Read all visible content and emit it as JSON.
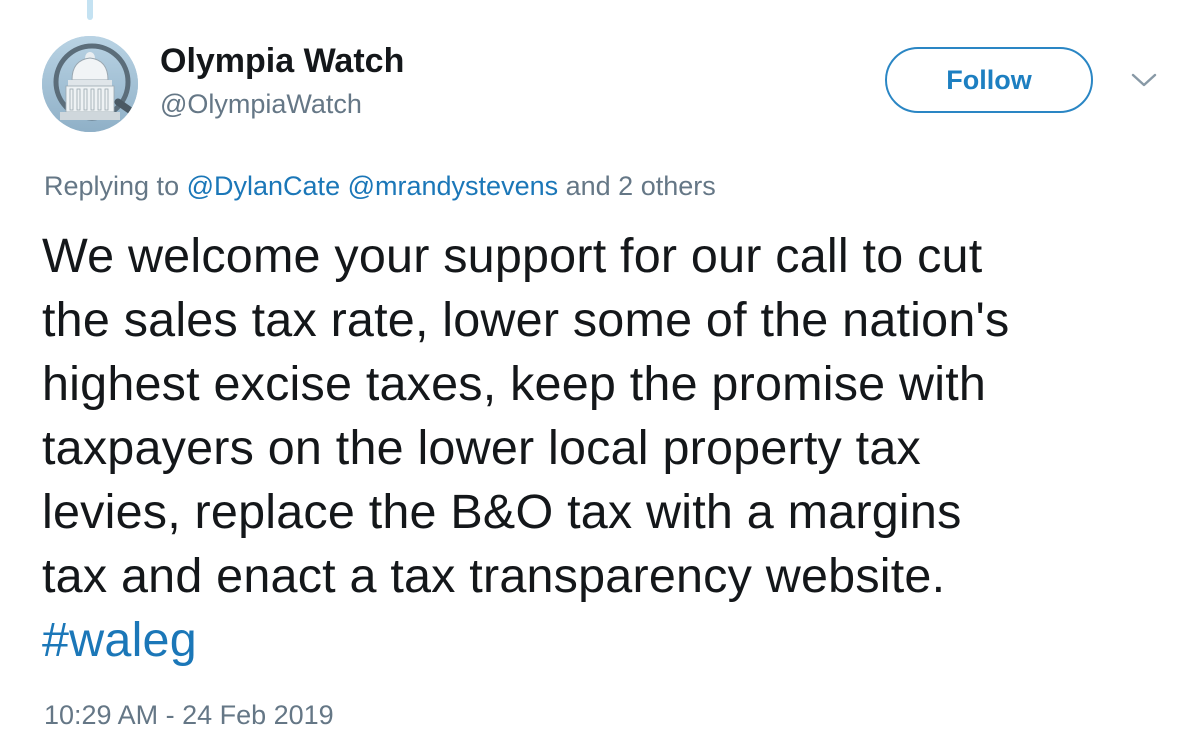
{
  "author": {
    "display_name": "Olympia Watch",
    "handle": "@OlympiaWatch",
    "avatar_icon": "capitol-dome-avatar"
  },
  "follow_button": {
    "label": "Follow"
  },
  "menu": {
    "icon": "chevron-down-icon"
  },
  "reply_context": {
    "prefix": "Replying to",
    "mentions": [
      "@DylanCate",
      "@mrandystevens"
    ],
    "suffix": "and 2 others"
  },
  "tweet": {
    "lines": [
      "We welcome your support for our call to cut",
      "the sales tax rate, lower some of the nation's",
      "highest excise taxes, keep the promise with",
      "taxpayers on the lower local property tax",
      "levies, replace the B&O tax with a margins",
      "tax and enact a tax transparency website."
    ],
    "hashtag": "#waleg"
  },
  "timestamp": "10:29 AM - 24 Feb 2019",
  "colors": {
    "link": "#1b77b8",
    "secondary_text": "#657786",
    "primary_text": "#14171a",
    "thread_line": "#c4e2f2"
  }
}
